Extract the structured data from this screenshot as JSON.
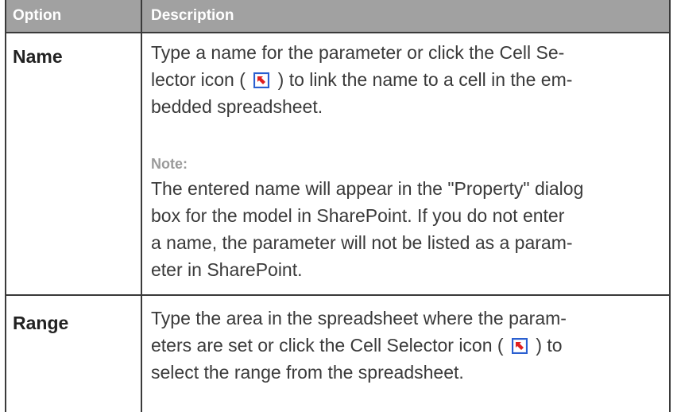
{
  "table": {
    "headers": {
      "option": "Option",
      "description": "Description"
    },
    "rows": [
      {
        "option": "Name",
        "description_lines": [
          {
            "before": "Type a name for the parameter or click the Cell Se-"
          },
          {
            "before": "lector icon (",
            "icon": "cell-selector-icon",
            "after": ") to link the name to a cell in the em-"
          },
          {
            "before": "bedded spreadsheet."
          }
        ],
        "note_label": "Note:",
        "note_lines": [
          "The entered name will appear in the \"Property\" dialog",
          "box for the model in SharePoint. If you do not enter",
          "a name, the parameter will not be listed as a param-",
          "eter in SharePoint."
        ]
      },
      {
        "option": "Range",
        "description_lines": [
          {
            "before": "Type the area in the spreadsheet where the param-"
          },
          {
            "before": "eters are set or click the Cell Selector icon (",
            "icon": "cell-selector-icon",
            "after": ") to"
          },
          {
            "before": "select the range from the spreadsheet."
          }
        ]
      }
    ]
  },
  "colors": {
    "header_bg": "#a1a1a1",
    "border": "#3a3a3a",
    "note_label": "#9a9a9a",
    "icon_red": "#e02020",
    "icon_blue": "#2a5fd0"
  }
}
